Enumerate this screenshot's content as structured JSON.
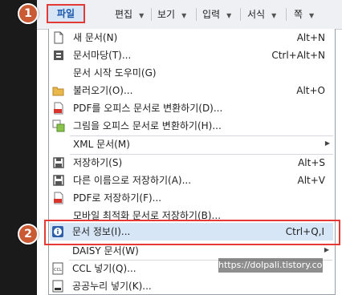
{
  "menubar": {
    "file": "파일",
    "edit": "편집",
    "view": "보기",
    "insert": "입력",
    "format": "서식",
    "page": "쪽"
  },
  "badges": {
    "step1": "1",
    "step2": "2"
  },
  "menu": {
    "new_doc": {
      "label": "새 문서(N)",
      "shortcut": "Alt+N",
      "icon": "new-document-icon"
    },
    "template": {
      "label": "문서마당(T)...",
      "shortcut": "Ctrl+Alt+N",
      "icon": "template-icon"
    },
    "wizard": {
      "label": "문서 시작 도우미(G)"
    },
    "open": {
      "label": "불러오기(O)...",
      "shortcut": "Alt+O",
      "icon": "folder-open-icon"
    },
    "pdf_to_office": {
      "label": "PDF를 오피스 문서로 변환하기(D)...",
      "icon": "pdf-icon"
    },
    "image_to_office": {
      "label": "그림을 오피스 문서로 변환하기(H)...",
      "icon": "image-convert-icon"
    },
    "xml": {
      "label": "XML 문서(M)"
    },
    "save": {
      "label": "저장하기(S)",
      "shortcut": "Alt+S",
      "icon": "save-icon"
    },
    "save_as": {
      "label": "다른 이름으로 저장하기(A)...",
      "shortcut": "Alt+V",
      "icon": "save-as-icon"
    },
    "save_pdf": {
      "label": "PDF로 저장하기(F)...",
      "icon": "save-pdf-icon"
    },
    "save_mobile": {
      "label": "모바일 최적화 문서로 저장하기(B)..."
    },
    "doc_info": {
      "label": "문서 정보(I)...",
      "shortcut": "Ctrl+Q,I",
      "icon": "info-icon"
    },
    "daisy": {
      "label": "DAISY 문서(W)"
    },
    "ccl": {
      "label": "CCL 넣기(Q)...",
      "icon": "ccl-icon"
    },
    "kogl": {
      "label": "공공누리 넣기(K)...",
      "icon": "open-license-icon"
    }
  },
  "watermark": "https://dolpali.tistory.com",
  "colors": {
    "highlight_border": "#e53935",
    "badge": "#c95a33",
    "selected_bg": "#d6e6f7"
  }
}
